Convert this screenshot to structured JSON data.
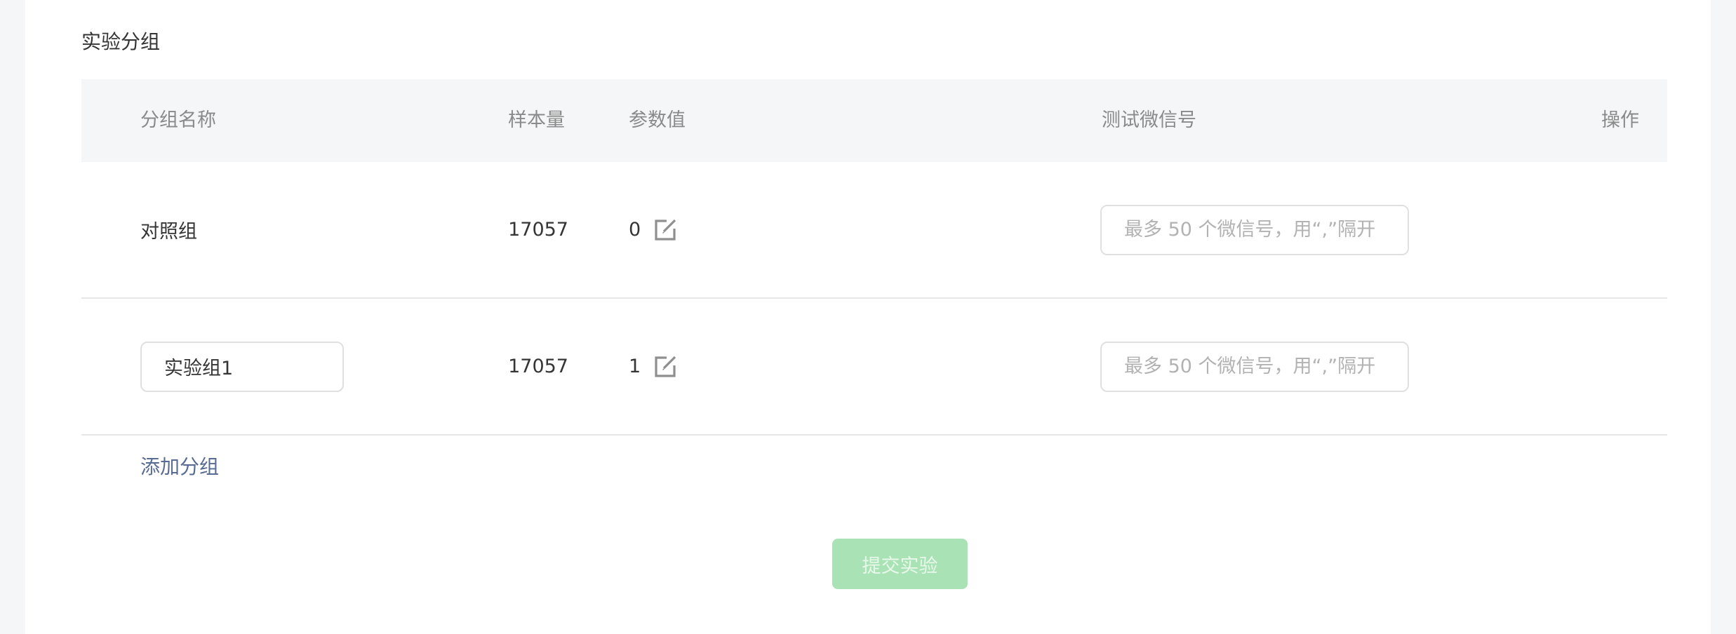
{
  "section": {
    "title": "实验分组"
  },
  "table": {
    "headers": {
      "group_name": "分组名称",
      "sample_size": "样本量",
      "param_value": "参数值",
      "test_wechat": "测试微信号",
      "actions": "操作"
    },
    "rows": [
      {
        "group_name": "对照组",
        "sample_size": "17057",
        "param_value": "0",
        "wechat_placeholder": "最多 50 个微信号，用“,”隔开",
        "wechat_value": ""
      },
      {
        "group_name_input": "实验组1",
        "sample_size": "17057",
        "param_value": "1",
        "wechat_placeholder": "最多 50 个微信号，用“,”隔开",
        "wechat_value": ""
      }
    ]
  },
  "add_group_label": "添加分组",
  "submit_label": "提交实验",
  "icons": {
    "edit": "edit-icon"
  },
  "colors": {
    "link": "#576b95",
    "submit_disabled_bg": "#a9e2b5",
    "header_bg": "#f5f6f7"
  }
}
